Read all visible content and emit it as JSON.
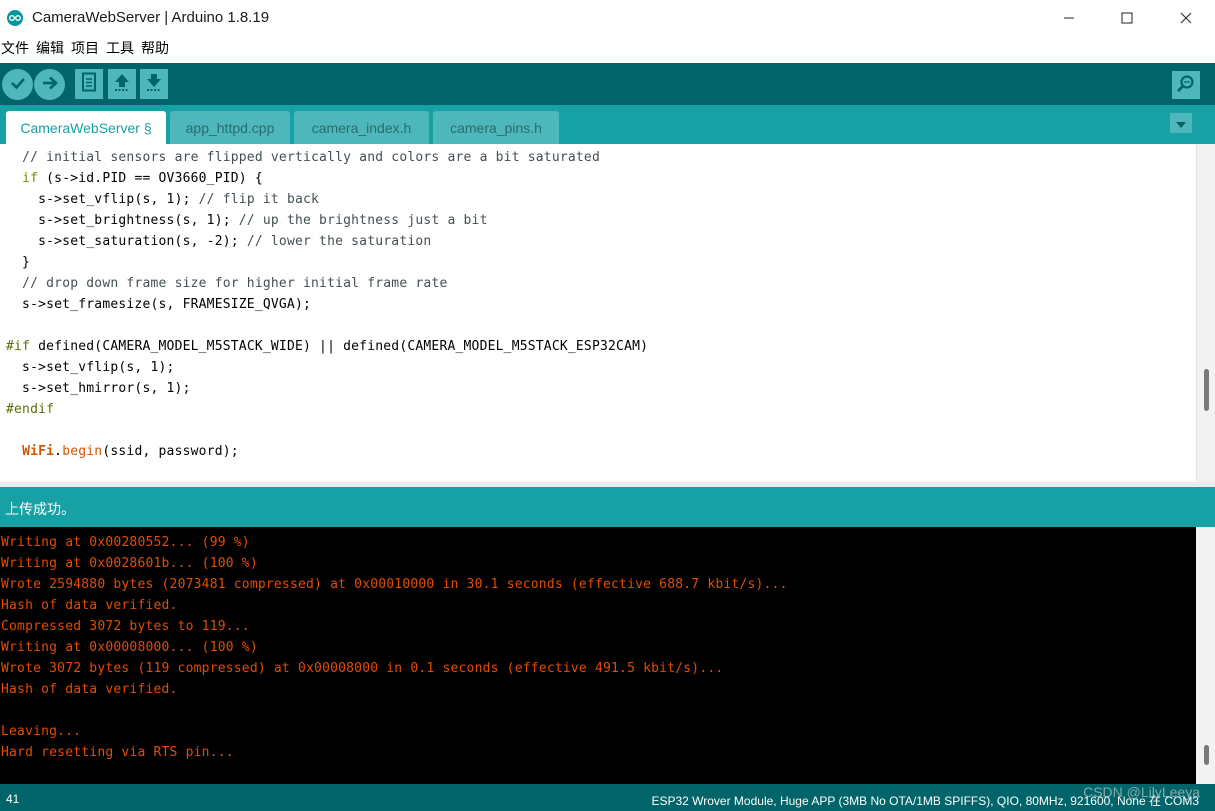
{
  "window": {
    "title": "CameraWebServer | Arduino 1.8.19",
    "app_icon": "arduino-logo-icon",
    "controls": [
      "minimize-icon",
      "maximize-icon",
      "close-icon"
    ]
  },
  "menu": {
    "items": [
      "文件",
      "编辑",
      "项目",
      "工具",
      "帮助"
    ]
  },
  "toolbar": {
    "buttons": [
      "verify-icon",
      "upload-icon",
      "new-icon",
      "open-icon",
      "save-icon"
    ],
    "right_button": "serial-monitor-icon"
  },
  "tabs": {
    "items": [
      "CameraWebServer §",
      "app_httpd.cpp",
      "camera_index.h",
      "camera_pins.h"
    ],
    "active_index": 0,
    "menu_icon": "tab-menu-icon"
  },
  "editor": {
    "lines": [
      [
        {
          "t": "  ",
          "c": ""
        },
        {
          "t": "// initial sensors are flipped vertically and colors are a bit saturated",
          "c": "cm"
        }
      ],
      [
        {
          "t": "  ",
          "c": ""
        },
        {
          "t": "if",
          "c": "kw"
        },
        {
          "t": " (s->id.PID == OV3660_PID) {",
          "c": ""
        }
      ],
      [
        {
          "t": "    s->",
          "c": ""
        },
        {
          "t": "set_vflip",
          "c": ""
        },
        {
          "t": "(s, 1); ",
          "c": ""
        },
        {
          "t": "// flip it back",
          "c": "cm"
        }
      ],
      [
        {
          "t": "    s->set_brightness(s, 1); ",
          "c": ""
        },
        {
          "t": "// up the brightness just a bit",
          "c": "cm"
        }
      ],
      [
        {
          "t": "    s->set_saturation(s, -2); ",
          "c": ""
        },
        {
          "t": "// lower the saturation",
          "c": "cm"
        }
      ],
      [
        {
          "t": "  }",
          "c": ""
        }
      ],
      [
        {
          "t": "  ",
          "c": ""
        },
        {
          "t": "// drop down frame size for higher initial frame rate",
          "c": "cm"
        }
      ],
      [
        {
          "t": "  s->set_framesize(s, FRAMESIZE_QVGA);",
          "c": ""
        }
      ],
      [
        {
          "t": "",
          "c": ""
        }
      ],
      [
        {
          "t": "#if",
          "c": "pp"
        },
        {
          "t": " defined(CAMERA_MODEL_M5STACK_WIDE) || defined(CAMERA_MODEL_M5STACK_ESP32CAM)",
          "c": ""
        }
      ],
      [
        {
          "t": "  s->set_vflip(s, 1);",
          "c": ""
        }
      ],
      [
        {
          "t": "  s->set_hmirror(s, 1);",
          "c": ""
        }
      ],
      [
        {
          "t": "#endif",
          "c": "pp"
        }
      ],
      [
        {
          "t": "",
          "c": ""
        }
      ],
      [
        {
          "t": "  ",
          "c": ""
        },
        {
          "t": "WiFi",
          "c": "kwb"
        },
        {
          "t": ".",
          "c": ""
        },
        {
          "t": "begin",
          "c": "fn"
        },
        {
          "t": "(ssid, password);",
          "c": ""
        }
      ]
    ]
  },
  "status": {
    "message": "上传成功。"
  },
  "console": {
    "lines": [
      "Writing at 0x00280552... (99 %)",
      "Writing at 0x0028601b... (100 %)",
      "Wrote 2594880 bytes (2073481 compressed) at 0x00010000 in 30.1 seconds (effective 688.7 kbit/s)...",
      "Hash of data verified.",
      "Compressed 3072 bytes to 119...",
      "Writing at 0x00008000... (100 %)",
      "Wrote 3072 bytes (119 compressed) at 0x00008000 in 0.1 seconds (effective 491.5 kbit/s)...",
      "Hash of data verified.",
      "",
      "Leaving...",
      "Hard resetting via RTS pin..."
    ]
  },
  "bottom": {
    "line_number": "41",
    "board_info": "ESP32 Wrover Module, Huge APP (3MB No OTA/1MB SPIFFS), QIO, 80MHz, 921600, None 在 COM3"
  },
  "watermark": "CSDN @LilyLeeya",
  "colors": {
    "toolbar": "#006468",
    "tabbar": "#17a1a5",
    "console_text": "#e34c00"
  }
}
